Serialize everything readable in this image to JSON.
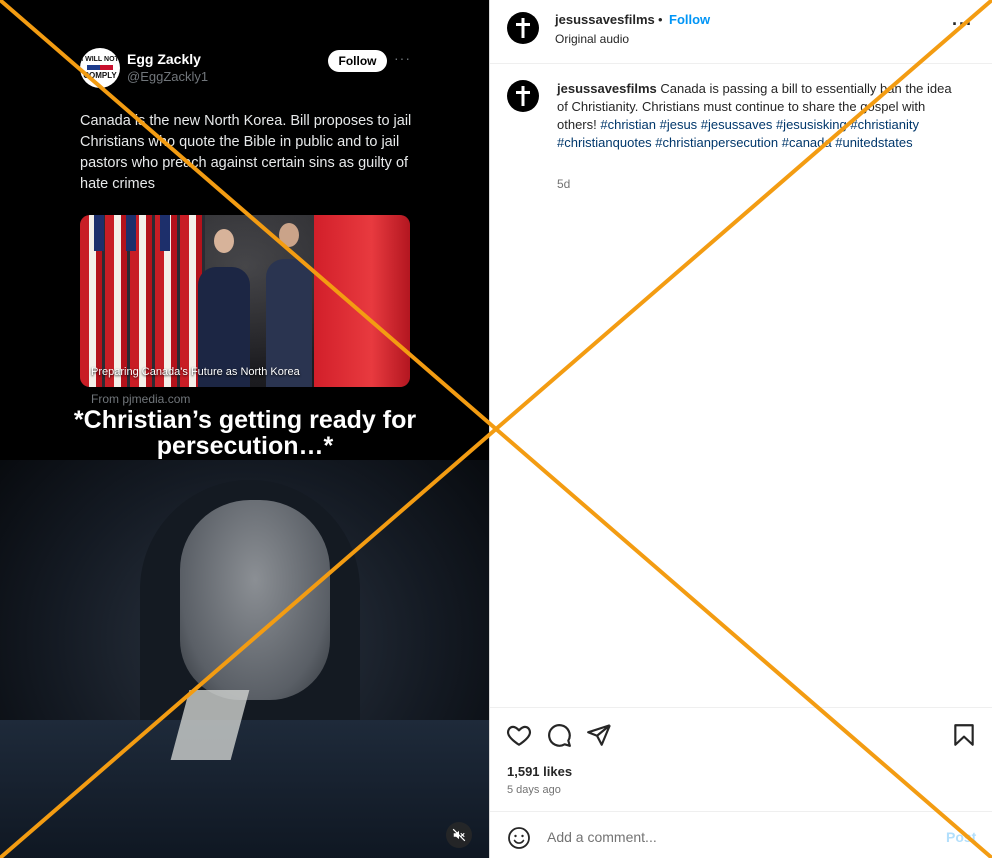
{
  "tweet": {
    "author_name": "Egg Zackly",
    "author_handle": "@EggZackly1",
    "avatar_text_top": "I WILL NOT",
    "avatar_text_bottom": "COMPLY",
    "follow_label": "Follow",
    "more_label": "···",
    "text": "Canada is the new North Korea. Bill proposes to jail Christians who quote the Bible in public and to jail pastors who preach against certain sins as guilty of hate crimes",
    "card_caption": "Preparing Canada's Future as North Korea",
    "card_source": "From pjmedia.com"
  },
  "video": {
    "overlay_text": "*Christian’s getting ready for persecution…*",
    "mute_icon": "speaker-muted-icon"
  },
  "post": {
    "username": "jesussavesfilms",
    "dot": "•",
    "follow_label": "Follow",
    "audio_label": "Original audio",
    "more_label": "···",
    "caption_user": "jesussavesfilms",
    "caption_text": " Canada is passing a bill to essentially ban the idea of Christianity. Christians must continue to share the gospel with others! ",
    "hashtags": "#christian #jesus #jesussaves #jesusisking #christianity #christianquotes #christianpersecution #canada #unitedstates",
    "age": "5d",
    "likes": "1,591 likes",
    "date": "5 days ago",
    "comment_placeholder": "Add a comment...",
    "post_label": "Post"
  },
  "colors": {
    "x_overlay": "#f39c12",
    "follow_blue": "#0095f6",
    "hashtag": "#00376b"
  }
}
